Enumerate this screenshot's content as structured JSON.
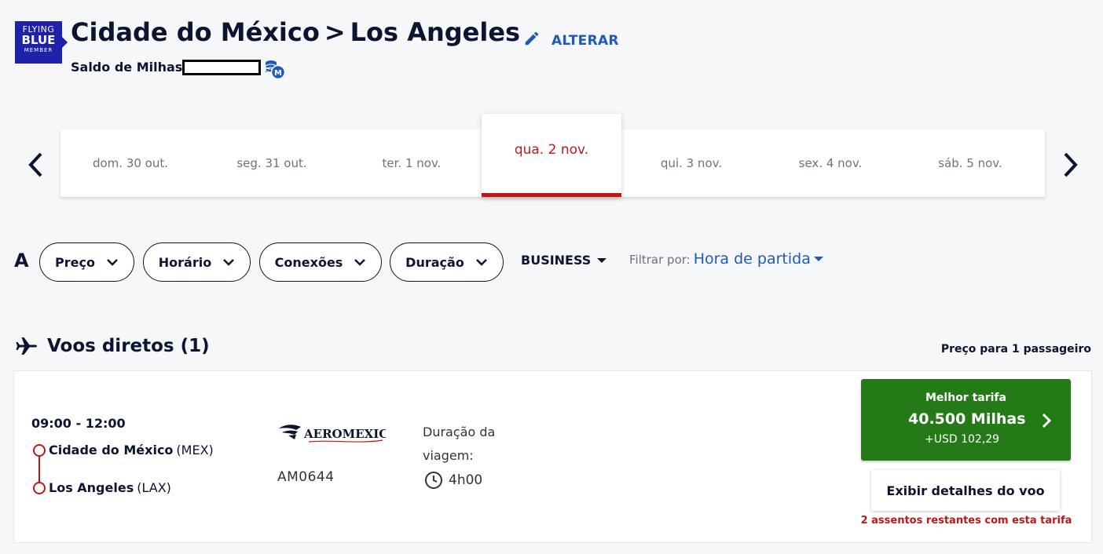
{
  "header": {
    "logo": {
      "line1": "FLYING",
      "line2": "BLUE",
      "line3": "MEMBER"
    },
    "origin": "Cidade do México",
    "separator": ">",
    "destination": "Los Angeles",
    "change_label": "ALTERAR",
    "miles_balance_label": "Saldo de Milhas",
    "coin_badge": "M"
  },
  "date_strip": {
    "items": [
      {
        "label": "dom. 30 out."
      },
      {
        "label": "seg. 31 out."
      },
      {
        "label": "ter. 1 nov."
      },
      {
        "label": "qua. 2 nov.",
        "active": true
      },
      {
        "label": "qui. 3 nov."
      },
      {
        "label": "sex. 4 nov."
      },
      {
        "label": "sáb. 5 nov."
      }
    ]
  },
  "filters": {
    "prefix": "A",
    "chips": [
      {
        "label": "Preço"
      },
      {
        "label": "Horário"
      },
      {
        "label": "Conexões"
      },
      {
        "label": "Duração"
      }
    ],
    "cabin": "BUSINESS",
    "filter_by_label": "Filtrar por:",
    "filter_by_value": "Hora de partida"
  },
  "section": {
    "title": "Voos diretos (1)",
    "price_note": "Preço para 1 passageiro"
  },
  "flight": {
    "times": "09:00 - 12:00",
    "origin_city": "Cidade do México",
    "origin_code": "(MEX)",
    "dest_city": "Los Angeles",
    "dest_code": "(LAX)",
    "airline": "AEROMEXICO",
    "flight_number": "AM0644",
    "duration_label": "Duração da viagem:",
    "duration": "4h00",
    "best_fare_label": "Melhor tarifa",
    "miles": "40.500 Milhas",
    "usd": "+USD 102,29",
    "details_label": "Exibir detalhes do voo",
    "seats_left": "2 assentos restantes com esta tarifa"
  },
  "colors": {
    "brand_blue": "#1e22aa",
    "link_blue": "#1f5ab8",
    "accent_red": "#c01616",
    "cta_green": "#247a17",
    "text_dark": "#0b1430"
  }
}
